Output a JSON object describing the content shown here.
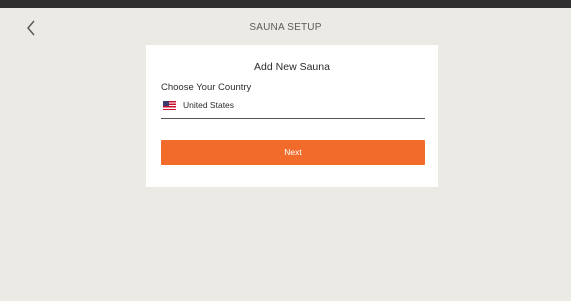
{
  "header": {
    "title": "SAUNA SETUP",
    "back_icon": "chevron-left-icon"
  },
  "card": {
    "title": "Add New Sauna",
    "country_label": "Choose Your Country",
    "country_value": "United States",
    "country_flag_icon": "us-flag-icon",
    "next_label": "Next"
  },
  "colors": {
    "background": "#eceae4",
    "accent": "#f26b2a",
    "card": "#ffffff"
  }
}
